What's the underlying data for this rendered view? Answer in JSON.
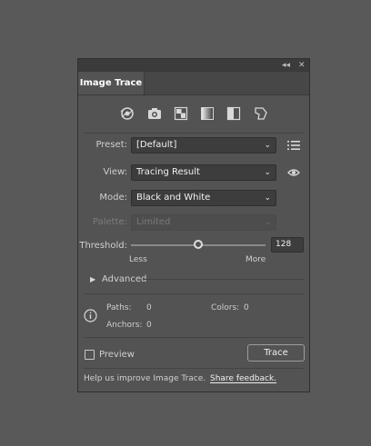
{
  "panel": {
    "title": "Image Trace",
    "collapse_glyph": "◂◂",
    "close_glyph": "✕"
  },
  "presets_icons": [
    "auto-color-icon",
    "high-color-icon",
    "low-color-icon",
    "grayscale-icon",
    "black-white-icon",
    "outline-icon"
  ],
  "preset": {
    "label": "Preset:",
    "value": "[Default]"
  },
  "view": {
    "label": "View:",
    "value": "Tracing Result"
  },
  "mode": {
    "label": "Mode:",
    "value": "Black and White"
  },
  "palette": {
    "label": "Palette:",
    "value": "Limited"
  },
  "threshold": {
    "label": "Threshold:",
    "value": "128",
    "level": 0.5,
    "less": "Less",
    "more": "More"
  },
  "advanced": {
    "label": "Advanced"
  },
  "info": {
    "paths_label": "Paths:",
    "paths_value": "0",
    "colors_label": "Colors:",
    "colors_value": "0",
    "anchors_label": "Anchors:",
    "anchors_value": "0"
  },
  "preview": {
    "label": "Preview"
  },
  "trace_button": "Trace",
  "footer": {
    "text": "Help us improve Image Trace.",
    "link": "Share feedback."
  }
}
